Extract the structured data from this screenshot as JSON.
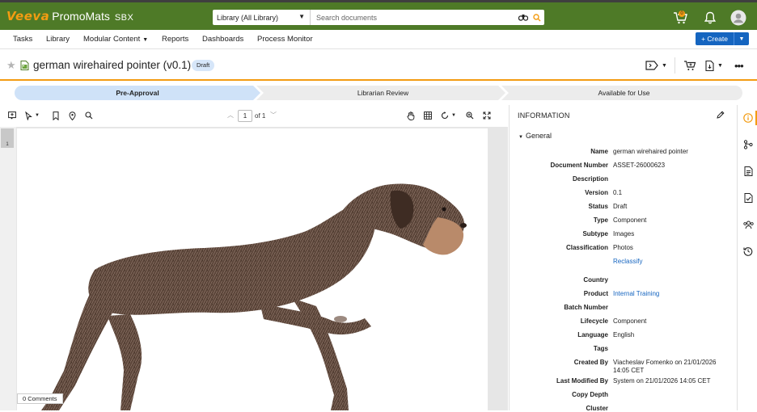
{
  "brand": {
    "veeva": "Veeva",
    "app": "PromoMats",
    "env": "SBX"
  },
  "search": {
    "scope": "Library (All Library)",
    "placeholder": "Search documents"
  },
  "topbar": {
    "cart_count": "0"
  },
  "nav": {
    "items": [
      "Tasks",
      "Library",
      "Modular Content",
      "Reports",
      "Dashboards",
      "Process Monitor"
    ]
  },
  "create": {
    "label": "+ Create"
  },
  "document": {
    "title": "german wirehaired pointer (v0.1)",
    "status_badge": "Draft"
  },
  "lifecycle": {
    "steps": [
      "Pre-Approval",
      "Librarian Review",
      "Available for Use"
    ],
    "active_index": 0
  },
  "viewer": {
    "page": "1",
    "of": "of 1",
    "thumb_number": "1",
    "comments": "0 Comments"
  },
  "info": {
    "title": "INFORMATION",
    "section": "General",
    "fields": [
      {
        "label": "Name",
        "value": "german wirehaired pointer"
      },
      {
        "label": "Document Number",
        "value": "ASSET-26000623"
      },
      {
        "label": "Description",
        "value": ""
      },
      {
        "label": "Version",
        "value": "0.1"
      },
      {
        "label": "Status",
        "value": "Draft"
      },
      {
        "label": "Type",
        "value": "Component"
      },
      {
        "label": "Subtype",
        "value": "Images"
      },
      {
        "label": "Classification",
        "value": "Photos"
      },
      {
        "label": "",
        "value": "Reclassify"
      },
      {
        "label": "Country",
        "value": ""
      },
      {
        "label": "Product",
        "value": "Internal Training"
      },
      {
        "label": "Batch Number",
        "value": ""
      },
      {
        "label": "Lifecycle",
        "value": "Component"
      },
      {
        "label": "Language",
        "value": "English"
      },
      {
        "label": "Tags",
        "value": ""
      },
      {
        "label": "Created By",
        "value": "Viacheslav Fomenko on 21/01/2026 14:05 CET"
      },
      {
        "label": "Last Modified By",
        "value": "System on 21/01/2026 14:05 CET"
      },
      {
        "label": "Copy Depth",
        "value": ""
      },
      {
        "label": "Cluster",
        "value": ""
      }
    ]
  },
  "colors": {
    "brand_green": "#4e7a27",
    "accent_orange": "#f39c12",
    "link_blue": "#1565c0",
    "active_step": "#cfe2f8"
  },
  "icons": {
    "rail": [
      "info-icon",
      "workflow-icon",
      "document-icon",
      "checklist-icon",
      "people-icon",
      "history-icon"
    ]
  }
}
